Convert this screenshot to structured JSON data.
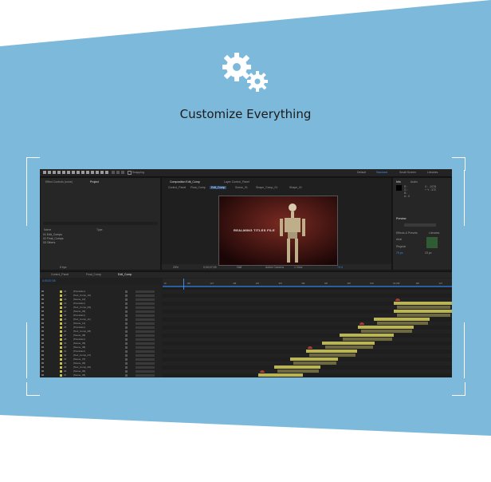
{
  "heading": "Customize Everything",
  "colors": {
    "banner": "#7db9db",
    "app_bg": "#1d1d1d",
    "accent_blue": "#3b8ce8",
    "bar_yellow": "#bab458",
    "bar_olive": "#6e6a3c",
    "marker_red": "#b33a2f"
  },
  "app": {
    "toolbar_toggle": "Snapping",
    "workspaces": [
      "Default",
      "Standard",
      "Small Screen",
      "Libraries"
    ],
    "active_workspace": "Standard",
    "left_tabs": [
      "Effect Controls (none)",
      "Project"
    ],
    "project": {
      "columns": [
        "Name",
        "Type"
      ],
      "items": [
        "01 Edit_Comps",
        "02 Final_Comps",
        "03 Others"
      ],
      "bpc": "8 bpc"
    },
    "viewer_tabs": [
      "Composition Edit_Comp",
      "Layer Control_Panel"
    ],
    "comp_breadcrumbs": [
      "Control_Panel",
      "Final_Comp",
      "Edit_Comp",
      "Scene_01",
      "Shape_Comp_01",
      "Shape_01"
    ],
    "comp_text": "REALMING TITLES FILE",
    "viewer_footer": {
      "zoom": "25%",
      "timecode": "0;00;07;05",
      "resolution": "Half",
      "camera": "Active Camera",
      "views": "1 View",
      "offset": "+0.0"
    },
    "right_tabs": [
      "Info",
      "Audio"
    ],
    "info_values": [
      "R :",
      "G :",
      "B :",
      "A : 0",
      "X : -1076",
      "+ Y : 372"
    ],
    "preview_label": "Preview",
    "effects_label": "Effects & Presets",
    "libraries_label": "Libraries",
    "char_font": "Arial",
    "char_style": "Regular",
    "char_sizes": [
      "75 px",
      "23 px"
    ],
    "timeline_tabs": [
      "Control_Panel",
      "Final_Comp",
      "Edit_Comp"
    ],
    "timeline_timecode": "0;00;07;05",
    "layer_header": "Layer Name",
    "ruler": [
      "0f",
      "06f",
      "12f",
      "18f",
      "24f",
      "30f",
      "36f",
      "42f",
      "48f",
      "54f",
      "01:00f",
      "06f",
      "12f"
    ],
    "layers": [
      {
        "num": "16",
        "name": "[Transition]",
        "color": "#c9c14b"
      },
      {
        "num": "17",
        "name": "[Text_Comp_10]",
        "color": "#c9c14b"
      },
      {
        "num": "18",
        "name": "[Scene_10]",
        "color": "#c9c14b"
      },
      {
        "num": "19",
        "name": "[Transition]",
        "color": "#c9c14b"
      },
      {
        "num": "20",
        "name": "[Text_Comp_09]",
        "color": "#c9c14b"
      },
      {
        "num": "21",
        "name": "[Scene_09]",
        "color": "#c9c14b"
      },
      {
        "num": "22",
        "name": "[Transition]",
        "color": "#c9c14b"
      },
      {
        "num": "23",
        "name": "[Text_Comp_11]",
        "color": "#c9c14b"
      },
      {
        "num": "24",
        "name": "[Scene_11]",
        "color": "#c9c14b"
      },
      {
        "num": "25",
        "name": "[Transition]",
        "color": "#c9c14b"
      },
      {
        "num": "26",
        "name": "[Text_Comp_08]",
        "color": "#c9c14b"
      },
      {
        "num": "27",
        "name": "[Scene_08]",
        "color": "#c9c14b"
      },
      {
        "num": "28",
        "name": "[Transition]",
        "color": "#c9c14b"
      },
      {
        "num": "29",
        "name": "[Scene_09]",
        "color": "#c9c14b"
      },
      {
        "num": "30",
        "name": "[Scene_08]",
        "color": "#c9c14b"
      },
      {
        "num": "31",
        "name": "[Transition]",
        "color": "#c9c14b"
      },
      {
        "num": "32",
        "name": "[Text_Comp_07]",
        "color": "#c9c14b"
      },
      {
        "num": "33",
        "name": "[Scene_07]",
        "color": "#c9c14b"
      },
      {
        "num": "34",
        "name": "[Scene_06]",
        "color": "#c9c14b"
      },
      {
        "num": "35",
        "name": "[Text_Comp_06]",
        "color": "#c9c14b"
      },
      {
        "num": "36",
        "name": "[Scene_06]",
        "color": "#c9c14b"
      },
      {
        "num": "37",
        "name": "[Scene_05]",
        "color": "#c9c14b"
      }
    ]
  }
}
